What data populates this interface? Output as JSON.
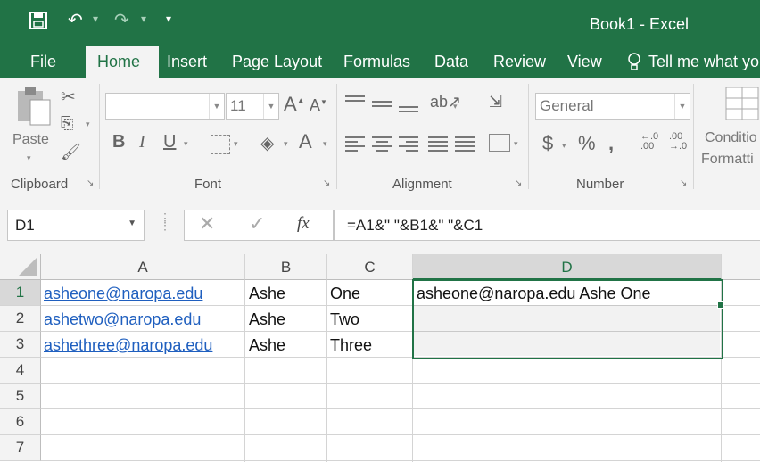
{
  "window": {
    "title": "Book1 - Excel"
  },
  "qat": {
    "save": "save-icon",
    "undo": "undo-icon",
    "redo": "redo-icon",
    "customize": "▾"
  },
  "tabs": [
    "File",
    "Home",
    "Insert",
    "Page Layout",
    "Formulas",
    "Data",
    "Review",
    "View"
  ],
  "tell_me": "Tell me what yo",
  "ribbon": {
    "clipboard": {
      "label": "Clipboard",
      "paste": "Paste"
    },
    "font": {
      "label": "Font",
      "name": "",
      "size": "11"
    },
    "alignment": {
      "label": "Alignment"
    },
    "number": {
      "label": "Number",
      "format": "General"
    },
    "styles": {
      "conditional_1": "Conditio",
      "conditional_2": "Formatti"
    }
  },
  "formula_bar": {
    "name_box": "D1",
    "formula": "=A1&\" \"&B1&\" \"&C1"
  },
  "columns": [
    "A",
    "B",
    "C",
    "D"
  ],
  "rows": [
    "1",
    "2",
    "3",
    "4",
    "5",
    "6",
    "7"
  ],
  "cells": [
    {
      "a": "asheone@naropa.edu",
      "b": "Ashe",
      "c": "One",
      "d": "asheone@naropa.edu Ashe One"
    },
    {
      "a": "ashetwo@naropa.edu",
      "b": "Ashe",
      "c": "Two",
      "d": ""
    },
    {
      "a": "ashethree@naropa.edu",
      "b": "Ashe",
      "c": "Three",
      "d": ""
    }
  ],
  "colors": {
    "accent": "#217346",
    "link": "#1f5fbf"
  }
}
